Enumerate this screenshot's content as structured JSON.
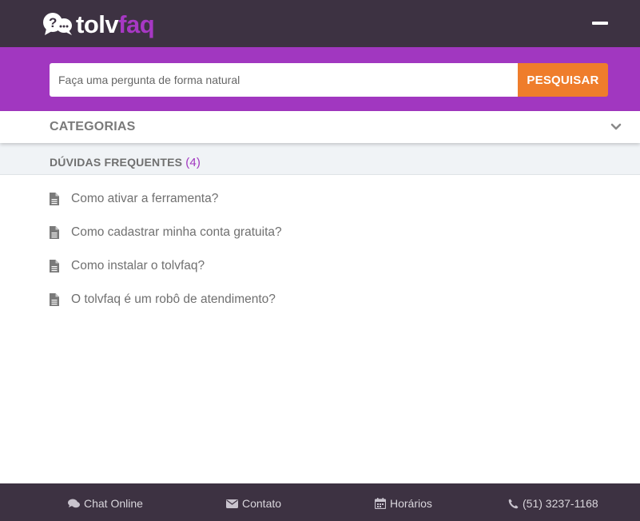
{
  "brand": {
    "part1": "tolv",
    "part2": "faq"
  },
  "colors": {
    "header_bg": "#3d3242",
    "search_bg": "#a137c0",
    "accent_orange": "#ef7d2b",
    "accent_purple": "#a738c4"
  },
  "search": {
    "placeholder": "Faça uma pergunta de forma natural",
    "button_label": "PESQUISAR"
  },
  "categories": {
    "label": "CATEGORIAS",
    "icon": "chevron-down-icon"
  },
  "faq": {
    "title": "DÚVIDAS FREQUENTES",
    "count": "(4)",
    "items": [
      {
        "text": "Como ativar a ferramenta?",
        "icon": "document-icon"
      },
      {
        "text": "Como cadastrar minha conta gratuita?",
        "icon": "document-icon"
      },
      {
        "text": "Como instalar o tolvfaq?",
        "icon": "document-icon"
      },
      {
        "text": "O tolvfaq é um robô de atendimento?",
        "icon": "document-icon"
      }
    ]
  },
  "footer": {
    "chat": {
      "label": "Chat Online",
      "icon": "chat-icon"
    },
    "contact": {
      "label": "Contato",
      "icon": "envelope-icon"
    },
    "hours": {
      "label": "Horários",
      "icon": "calendar-icon"
    },
    "phone": {
      "label": "(51) 3237-1168",
      "icon": "phone-icon"
    }
  }
}
